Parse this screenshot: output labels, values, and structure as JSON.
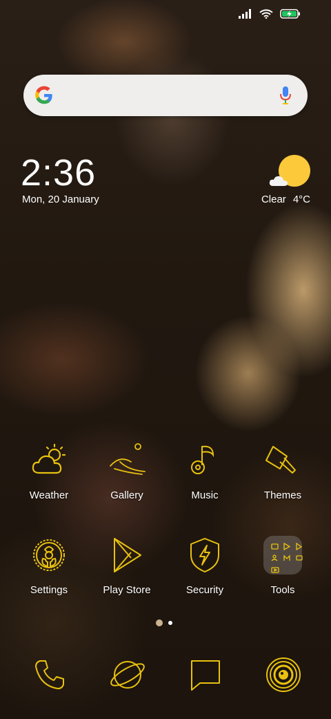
{
  "status_bar": {
    "icons": [
      "signal-icon",
      "wifi-icon",
      "battery-charging-icon"
    ],
    "accent": "#22c55e"
  },
  "search": {
    "icons": [
      "google-logo",
      "mic-icon"
    ]
  },
  "clock": {
    "time": "2:36",
    "date": "Mon, 20 January"
  },
  "weather": {
    "condition": "Clear",
    "temperature": "4°C",
    "sun_color": "#fcc93a"
  },
  "apps_row1": [
    {
      "label": "Weather",
      "icon": "weather-icon"
    },
    {
      "label": "Gallery",
      "icon": "gallery-icon"
    },
    {
      "label": "Music",
      "icon": "music-icon"
    },
    {
      "label": "Themes",
      "icon": "themes-icon"
    }
  ],
  "apps_row2": [
    {
      "label": "Settings",
      "icon": "settings-icon"
    },
    {
      "label": "Play Store",
      "icon": "play-store-icon"
    },
    {
      "label": "Security",
      "icon": "security-icon"
    },
    {
      "label": "Tools",
      "icon": "tools-folder-icon"
    }
  ],
  "page_indicator": {
    "pages": 2,
    "current": 1
  },
  "dock": [
    "phone-icon",
    "browser-icon",
    "messages-icon",
    "camera-icon"
  ],
  "icon_color": "#e8c20f"
}
